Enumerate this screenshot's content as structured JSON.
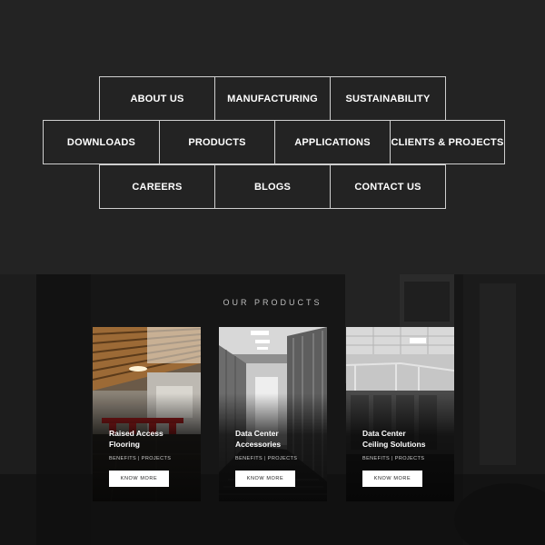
{
  "nav": {
    "items": [
      {
        "label": "ABOUT US"
      },
      {
        "label": "MANUFACTURING"
      },
      {
        "label": "SUSTAINABILITY"
      },
      {
        "label": "DOWNLOADS"
      },
      {
        "label": "PRODUCTS"
      },
      {
        "label": "APPLICATIONS"
      },
      {
        "label": "CLIENTS & PROJECTS"
      },
      {
        "label": "CAREERS"
      },
      {
        "label": "BLOGS"
      },
      {
        "label": "CONTACT US"
      }
    ]
  },
  "products": {
    "section_title": "OUR PRODUCTS",
    "cards": [
      {
        "title_line1": "Raised Access",
        "title_line2": "Flooring",
        "tags": "BENEFITS | PROJECTS",
        "button": "KNOW MORE"
      },
      {
        "title_line1": "Data Center",
        "title_line2": "Accessories",
        "tags": "BENEFITS | PROJECTS",
        "button": "KNOW MORE"
      },
      {
        "title_line1": "Data Center",
        "title_line2": "Ceiling Solutions",
        "tags": "BENEFITS | PROJECTS",
        "button": "KNOW MORE"
      }
    ]
  },
  "colors": {
    "background": "#232323",
    "nav_border": "#cfcfcf",
    "button_bg": "#ffffff"
  }
}
